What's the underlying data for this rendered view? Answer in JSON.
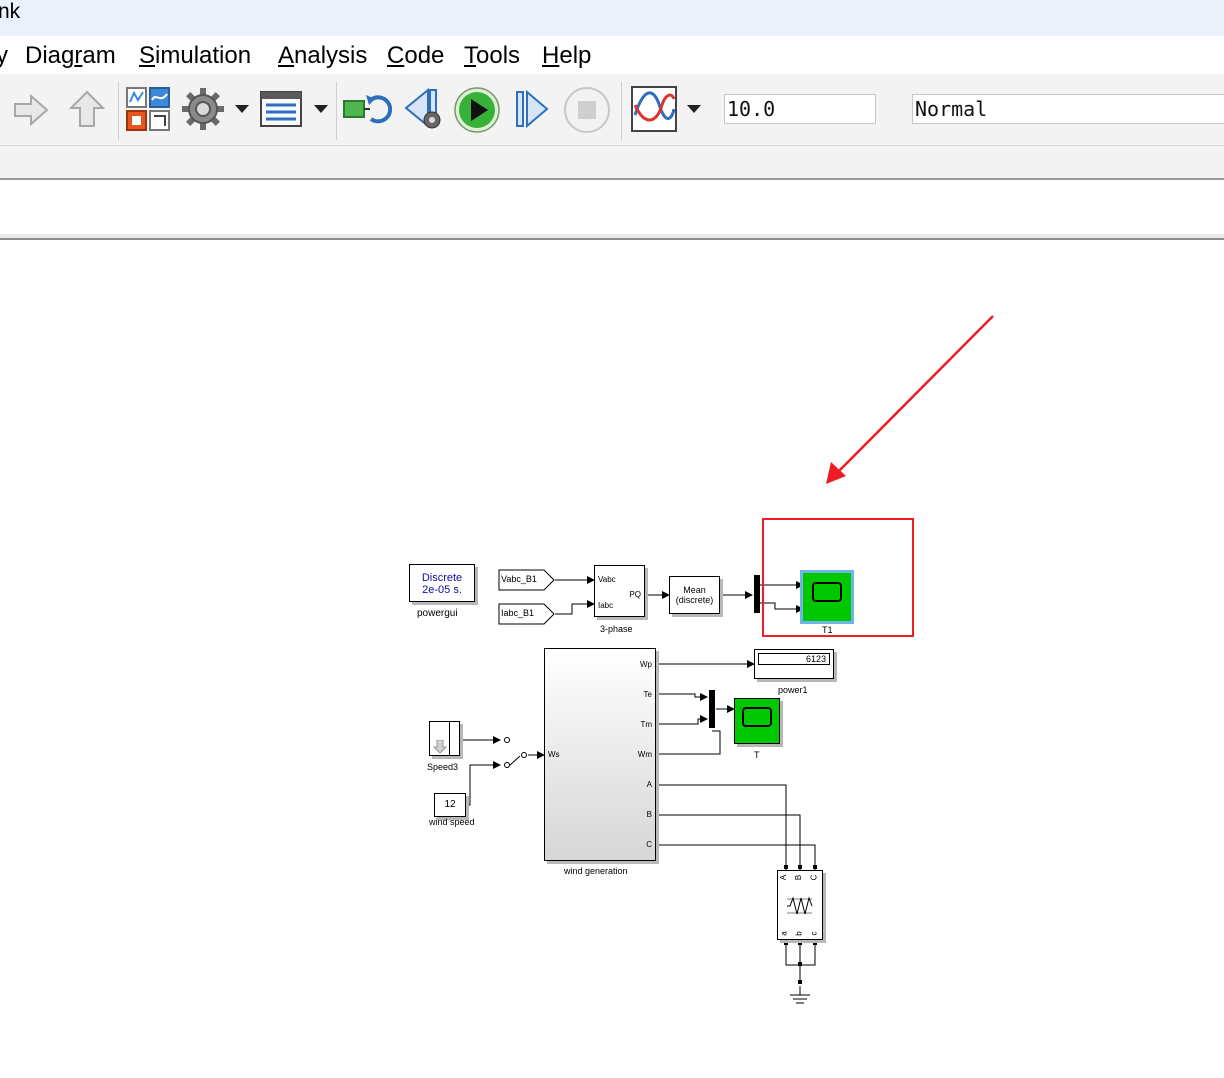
{
  "titlebar": {
    "title": "nk"
  },
  "menu": {
    "items": [
      {
        "pre": "",
        "u": "",
        "post": "y"
      },
      {
        "pre": "Diag",
        "u": "r",
        "post": "am"
      },
      {
        "pre": "",
        "u": "S",
        "post": "imulation"
      },
      {
        "pre": "",
        "u": "A",
        "post": "nalysis"
      },
      {
        "pre": "",
        "u": "C",
        "post": "ode"
      },
      {
        "pre": "",
        "u": "T",
        "post": "ools"
      },
      {
        "pre": "",
        "u": "H",
        "post": "elp"
      }
    ]
  },
  "toolbar": {
    "stop_time": "10.0",
    "sim_mode": "Normal",
    "icons": [
      "forward-arrow-icon",
      "up-arrow-icon",
      "library-browser-icon",
      "model-settings-gear-icon",
      "model-explorer-icon",
      "update-diagram-icon",
      "step-back-icon",
      "run-icon",
      "step-forward-icon",
      "stop-icon",
      "data-inspector-icon"
    ]
  },
  "diagram": {
    "powergui": {
      "line1": "Discrete",
      "line2": "2e-05 s.",
      "name": "powergui"
    },
    "goto_tags": {
      "vabc": "Vabc_B1",
      "iabc": "Iabc_B1"
    },
    "phase_block": {
      "port_vabc": "Vabc",
      "port_iabc": "Iabc",
      "port_pq": "PQ",
      "name": "3-phase"
    },
    "mean_block": {
      "line1": "Mean",
      "line2": "(discrete)"
    },
    "scope_t1": {
      "name": "T1"
    },
    "display": {
      "value": "6123",
      "name": "power1"
    },
    "scope_t": {
      "name": "T"
    },
    "generator": {
      "name": "wind generation",
      "port_in": "Ws",
      "ports_out": [
        "Wp",
        "Te",
        "Tm",
        "Wm",
        "A",
        "B",
        "C"
      ]
    },
    "speed3": {
      "name": "Speed3"
    },
    "wind_speed": {
      "value": "12",
      "name": "wind speed"
    },
    "load": {
      "top_ports": [
        "A",
        "B",
        "C"
      ],
      "bottom_ports": [
        "a",
        "b",
        "c"
      ]
    },
    "annotation": {
      "color": "#ee1c24"
    }
  },
  "colors": {
    "scope_green": "#00c800",
    "highlight": "#6fb5ea",
    "accent_red": "#ee1c24"
  }
}
